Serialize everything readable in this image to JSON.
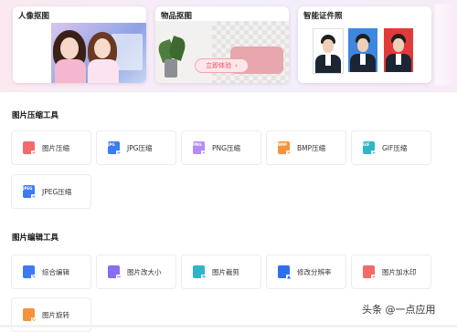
{
  "feature_cards": [
    {
      "title": "人像抠图"
    },
    {
      "title": "物品抠图",
      "cta_label": "立即体验",
      "cta_arrow": "›"
    },
    {
      "title": "智能证件照"
    }
  ],
  "compress_section": {
    "title": "图片压缩工具",
    "tools": [
      {
        "label": "图片压缩",
        "icon": "image-compress-icon",
        "color": "#f46a6a",
        "tag": ""
      },
      {
        "label": "JPG压缩",
        "icon": "jpg-file-icon",
        "color": "#3d7bf5",
        "tag": "JPG"
      },
      {
        "label": "PNG压缩",
        "icon": "png-file-icon",
        "color": "#b48cf5",
        "tag": "PNG"
      },
      {
        "label": "BMP压缩",
        "icon": "bmp-file-icon",
        "color": "#f5933d",
        "tag": "BMP"
      },
      {
        "label": "GIF压缩",
        "icon": "gif-file-icon",
        "color": "#2fb5c8",
        "tag": "GIF"
      },
      {
        "label": "JPEG压缩",
        "icon": "jpeg-file-icon",
        "color": "#3d7bf5",
        "tag": "JPEG"
      }
    ]
  },
  "edit_section": {
    "title": "图片编辑工具",
    "tools": [
      {
        "label": "综合编辑",
        "icon": "image-edit-icon",
        "color": "#3d7bf5",
        "tag": ""
      },
      {
        "label": "图片改大小",
        "icon": "resize-icon",
        "color": "#8a6cf0",
        "tag": ""
      },
      {
        "label": "图片裁剪",
        "icon": "crop-icon",
        "color": "#2fb5c8",
        "tag": ""
      },
      {
        "label": "修改分辨率",
        "icon": "resolution-icon",
        "color": "#2f6ef0",
        "tag": ""
      },
      {
        "label": "图片加水印",
        "icon": "watermark-icon",
        "color": "#f46a6a",
        "tag": ""
      },
      {
        "label": "图片旋转",
        "icon": "rotate-icon",
        "color": "#f5933d",
        "tag": ""
      }
    ]
  },
  "watermark": "头条 @一点应用"
}
